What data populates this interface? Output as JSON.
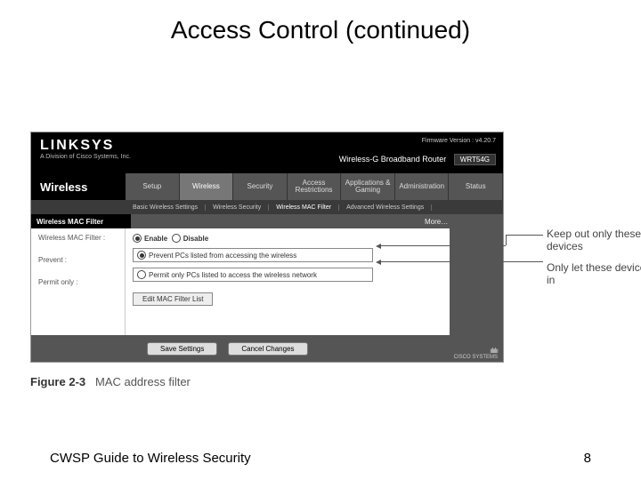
{
  "slide": {
    "title": "Access Control (continued)",
    "footer_left": "CWSP Guide to Wireless Security",
    "page_number": "8"
  },
  "figure": {
    "number": "Figure 2-3",
    "caption": "MAC address filter"
  },
  "router": {
    "brand": "LINKSYS",
    "brand_sub": "A Division of Cisco Systems, Inc.",
    "firmware": "Firmware Version : v4.20.7",
    "product": "Wireless-G Broadband Router",
    "model": "WRT54G",
    "section": "Wireless",
    "tabs": [
      "Setup",
      "Wireless",
      "Security",
      "Access Restrictions",
      "Applications & Gaming",
      "Administration",
      "Status"
    ],
    "subtabs": [
      "Basic Wireless Settings",
      "Wireless Security",
      "Wireless MAC Filter",
      "Advanced Wireless Settings"
    ],
    "panel_label": "Wireless MAC Filter",
    "more": "More…",
    "left_labels": {
      "row1": "Wireless MAC Filter :",
      "row2": "Prevent :",
      "row3": "Permit only :"
    },
    "enable": "Enable",
    "disable": "Disable",
    "prevent_text": "Prevent PCs listed from accessing the wireless",
    "permit_text": "Permit only PCs listed to access the wireless network",
    "edit_btn": "Edit MAC Filter List",
    "save_btn": "Save Settings",
    "cancel_btn": "Cancel Changes",
    "cisco": "CISCO SYSTEMS"
  },
  "callouts": {
    "keep_out": "Keep out only these devices",
    "only_let": "Only let these devices in"
  }
}
